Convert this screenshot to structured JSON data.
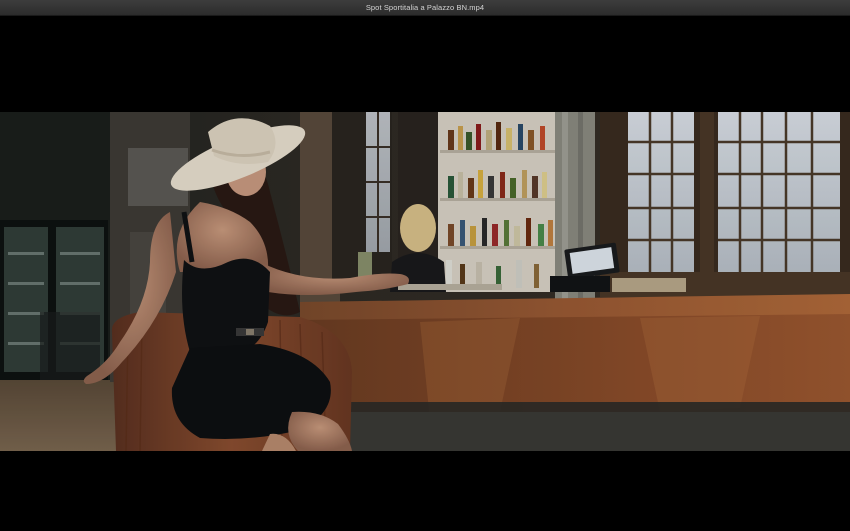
{
  "window": {
    "title": "Spot Sportitalia a Palazzo BN.mp4"
  },
  "player": {
    "frame_description_icon": "video-frame",
    "colors": {
      "titlebar": "#353535",
      "letterbox": "#000000",
      "bar_counter": "#8a4a2a",
      "dress": "#101214",
      "hat": "#e8dfcf"
    }
  }
}
